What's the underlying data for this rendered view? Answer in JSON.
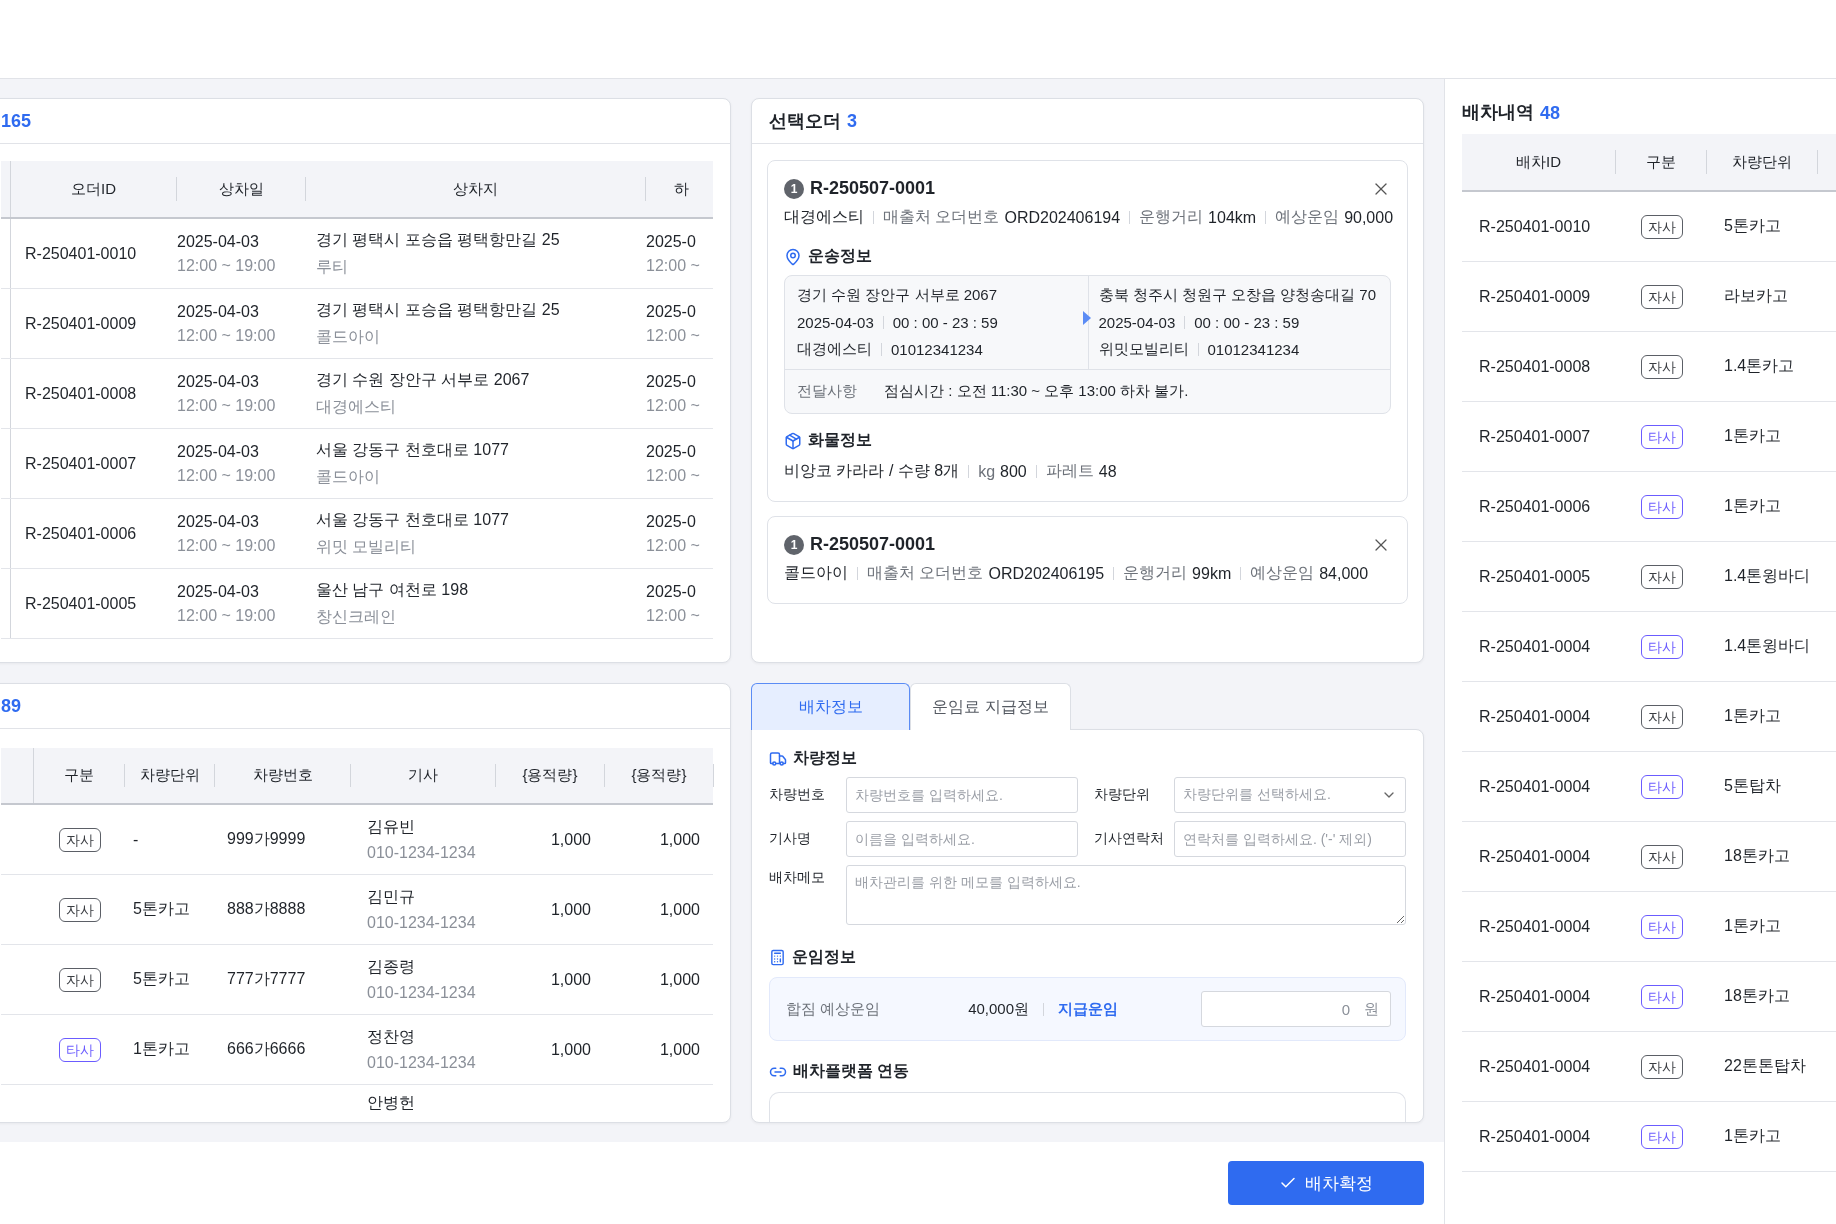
{
  "order_list": {
    "count": "165",
    "columns": [
      "오더ID",
      "상차일",
      "상차지",
      "하"
    ],
    "rows": [
      {
        "order_id": "R-250401-0010",
        "load_date": "2025-04-03",
        "load_time": "12:00 ~ 19:00",
        "load_address": "경기 평택시 포승읍 평택항만길 25",
        "load_company": "루티",
        "unload_date": "2025-0",
        "unload_time": "12:00 ~"
      },
      {
        "order_id": "R-250401-0009",
        "load_date": "2025-04-03",
        "load_time": "12:00 ~ 19:00",
        "load_address": "경기 평택시 포승읍 평택항만길 25",
        "load_company": "콜드아이",
        "unload_date": "2025-0",
        "unload_time": "12:00 ~"
      },
      {
        "order_id": "R-250401-0008",
        "load_date": "2025-04-03",
        "load_time": "12:00 ~ 19:00",
        "load_address": "경기 수원 장안구 서부로 2067",
        "load_company": "대경에스티",
        "unload_date": "2025-0",
        "unload_time": "12:00 ~"
      },
      {
        "order_id": "R-250401-0007",
        "load_date": "2025-04-03",
        "load_time": "12:00 ~ 19:00",
        "load_address": "서울 강동구 천호대로 1077",
        "load_company": "콜드아이",
        "unload_date": "2025-0",
        "unload_time": "12:00 ~"
      },
      {
        "order_id": "R-250401-0006",
        "load_date": "2025-04-03",
        "load_time": "12:00 ~ 19:00",
        "load_address": "서울 강동구 천호대로 1077",
        "load_company": "위밋 모빌리티",
        "unload_date": "2025-0",
        "unload_time": "12:00 ~"
      },
      {
        "order_id": "R-250401-0005",
        "load_date": "2025-04-03",
        "load_time": "12:00 ~ 19:00",
        "load_address": "울산 남구 여천로 198",
        "load_company": "창신크레인",
        "unload_date": "2025-0",
        "unload_time": "12:00 ~"
      }
    ]
  },
  "vehicle_list": {
    "count": "89",
    "columns": [
      "구분",
      "차량단위",
      "차량번호",
      "기사",
      "{용적량}",
      "{용적량}"
    ],
    "rows": [
      {
        "type": "자사",
        "kind": "own",
        "unit": "-",
        "plate": "999가9999",
        "driver": "김유빈",
        "phone": "010-1234-1234",
        "capacity_1": "1,000",
        "capacity_2": "1,000"
      },
      {
        "type": "자사",
        "kind": "own",
        "unit": "5톤카고",
        "plate": "888가8888",
        "driver": "김민규",
        "phone": "010-1234-1234",
        "capacity_1": "1,000",
        "capacity_2": "1,000"
      },
      {
        "type": "자사",
        "kind": "own",
        "unit": "5톤카고",
        "plate": "777가7777",
        "driver": "김종령",
        "phone": "010-1234-1234",
        "capacity_1": "1,000",
        "capacity_2": "1,000"
      },
      {
        "type": "타사",
        "kind": "other",
        "unit": "1톤카고",
        "plate": "666가6666",
        "driver": "정찬영",
        "phone": "010-1234-1234",
        "capacity_1": "1,000",
        "capacity_2": "1,000"
      },
      {
        "driver": "안병헌"
      }
    ]
  },
  "selected_orders": {
    "title": "선택오더",
    "count": "3",
    "cards": [
      {
        "index": "1",
        "order_id": "R-250507-0001",
        "company": "대경에스티",
        "sales_label": "매출처 오더번호",
        "sales_no": "ORD202406194",
        "distance_label": "운행거리",
        "distance": "104km",
        "fare_label": "예상운임",
        "fare": "90,000",
        "transport": {
          "title": "운송정보",
          "from": {
            "address": "경기 수원 장안구 서부로 2067",
            "date": "2025-04-03",
            "time": "00 : 00 - 23 : 59",
            "company": "대경에스티",
            "phone": "01012341234"
          },
          "to": {
            "address": "충북 청주시 청원구 오창읍 양청송대길 70",
            "date": "2025-04-03",
            "time": "00 : 00 - 23 : 59",
            "company": "위밋모빌리티",
            "phone": "01012341234"
          },
          "note_label": "전달사항",
          "note": "점심시간 : 오전 11:30 ~ 오후 13:00 하차 불가."
        },
        "cargo": {
          "title": "화물정보",
          "item": "비앙코 카라라 / 수량 8개",
          "weight_label": "kg",
          "weight": "800",
          "pallet_label": "파레트",
          "pallet": "48"
        }
      },
      {
        "index": "1",
        "order_id": "R-250507-0001",
        "company": "콜드아이",
        "sales_label": "매출처 오더번호",
        "sales_no": "ORD202406195",
        "distance_label": "운행거리",
        "distance": "99km",
        "fare_label": "예상운임",
        "fare": "84,000"
      }
    ]
  },
  "dispatch_form": {
    "tabs": [
      {
        "label": "배차정보",
        "selected": true
      },
      {
        "label": "운임료 지급정보",
        "selected": false
      }
    ],
    "vehicle_title": "차량정보",
    "fields": [
      {
        "label": "차량번호",
        "placeholder": "차량번호를 입력하세요.",
        "kind": "text"
      },
      {
        "label": "차량단위",
        "placeholder": "차량단위를 선택하세요.",
        "kind": "select"
      },
      {
        "label": "기사명",
        "placeholder": "이름을 입력하세요.",
        "kind": "text"
      },
      {
        "label": "기사연락처",
        "placeholder": "연락처를 입력하세요. ('-' 제외)",
        "kind": "text"
      },
      {
        "label": "배차메모",
        "placeholder": "배차관리를 위한 메모를 입력하세요.",
        "kind": "textarea"
      }
    ],
    "fare": {
      "title": "운임정보",
      "label": "합짐 예상운임",
      "amount": "40,000원",
      "pay_label": "지급운임",
      "pay_value": "0",
      "unit": "원"
    },
    "platform_title": "배차플랫폼 연동"
  },
  "confirm_button": "배차확정",
  "dispatch_history": {
    "title": "배차내역",
    "count": "48",
    "columns": [
      "배차ID",
      "구분",
      "차량단위"
    ],
    "rows": [
      {
        "id": "R-250401-0010",
        "type": "자사",
        "kind": "own",
        "unit": "5톤카고"
      },
      {
        "id": "R-250401-0009",
        "type": "자사",
        "kind": "own",
        "unit": "라보카고"
      },
      {
        "id": "R-250401-0008",
        "type": "자사",
        "kind": "own",
        "unit": "1.4톤카고"
      },
      {
        "id": "R-250401-0007",
        "type": "타사",
        "kind": "other",
        "unit": "1톤카고"
      },
      {
        "id": "R-250401-0006",
        "type": "타사",
        "kind": "other",
        "unit": "1톤카고"
      },
      {
        "id": "R-250401-0005",
        "type": "자사",
        "kind": "own",
        "unit": "1.4톤윙바디"
      },
      {
        "id": "R-250401-0004",
        "type": "타사",
        "kind": "other",
        "unit": "1.4톤윙바디"
      },
      {
        "id": "R-250401-0004",
        "type": "자사",
        "kind": "own",
        "unit": "1톤카고"
      },
      {
        "id": "R-250401-0004",
        "type": "타사",
        "kind": "other",
        "unit": "5톤탑차"
      },
      {
        "id": "R-250401-0004",
        "type": "자사",
        "kind": "own",
        "unit": "18톤카고"
      },
      {
        "id": "R-250401-0004",
        "type": "타사",
        "kind": "other",
        "unit": "1톤카고"
      },
      {
        "id": "R-250401-0004",
        "type": "타사",
        "kind": "other",
        "unit": "18톤카고"
      },
      {
        "id": "R-250401-0004",
        "type": "자사",
        "kind": "own",
        "unit": "22톤톤탑차"
      },
      {
        "id": "R-250401-0004",
        "type": "타사",
        "kind": "other",
        "unit": "1톤카고"
      }
    ]
  }
}
